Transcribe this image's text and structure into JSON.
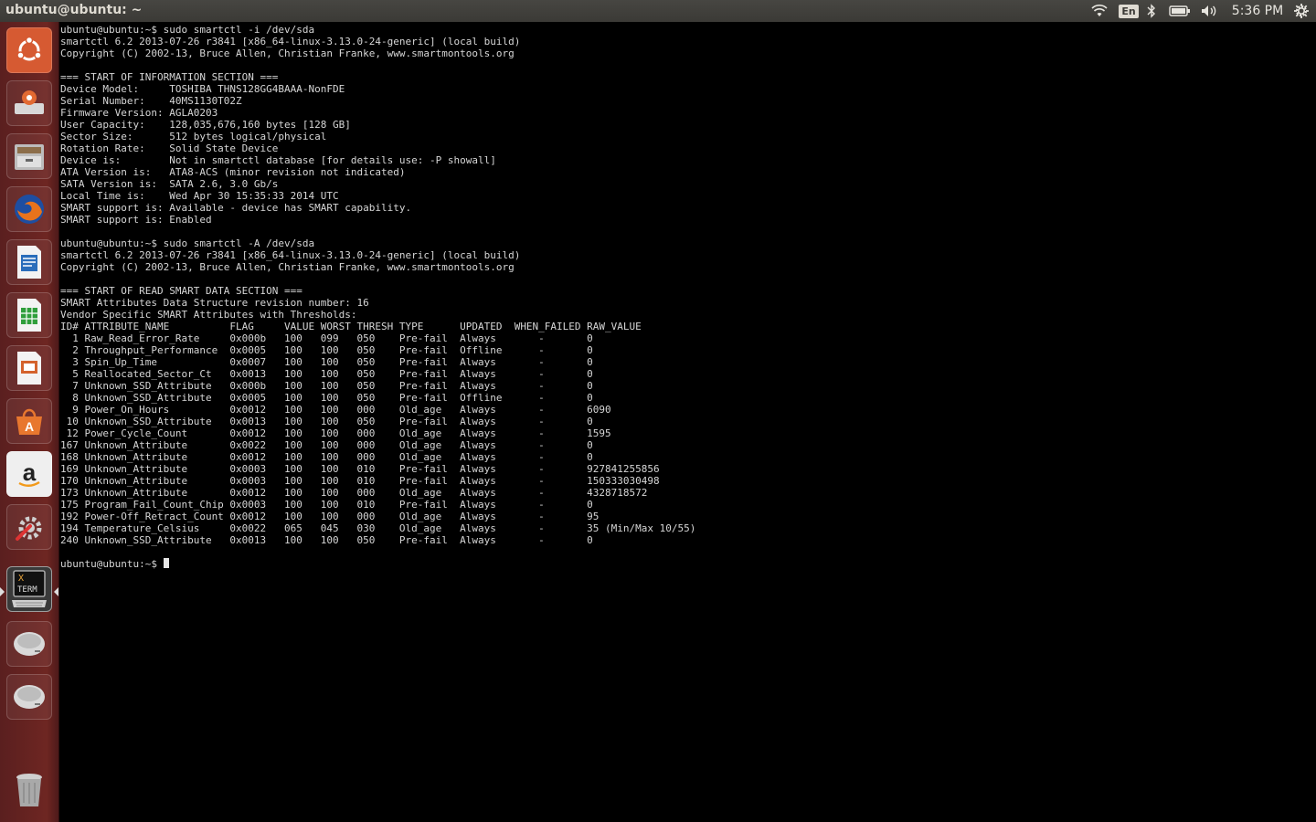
{
  "topbar": {
    "window_title": "ubuntu@ubuntu: ~",
    "language": "En",
    "clock": "5:36 PM",
    "icons": [
      "wifi-icon",
      "keyboard-language-icon",
      "bluetooth-icon",
      "battery-icon",
      "volume-icon",
      "session-gear-icon"
    ]
  },
  "launcher": {
    "items": [
      {
        "name": "ubuntu-dash-icon"
      },
      {
        "name": "system-installer-icon"
      },
      {
        "name": "files-icon"
      },
      {
        "name": "firefox-icon"
      },
      {
        "name": "libreoffice-writer-icon"
      },
      {
        "name": "libreoffice-calc-icon"
      },
      {
        "name": "libreoffice-impress-icon"
      },
      {
        "name": "software-center-icon"
      },
      {
        "name": "amazon-icon"
      },
      {
        "name": "system-settings-icon"
      },
      {
        "name": "xterm-icon",
        "label": "X TERM",
        "active": true
      },
      {
        "name": "drive-icon"
      },
      {
        "name": "drive-icon"
      },
      {
        "name": "trash-icon"
      }
    ]
  },
  "colors": {
    "launcher": "#6e2622",
    "topbar": "#3c3b37",
    "terminal_bg": "#000000",
    "terminal_fg": "#d6d6d6"
  },
  "terminal": {
    "lines": [
      "ubuntu@ubuntu:~$ sudo smartctl -i /dev/sda",
      "smartctl 6.2 2013-07-26 r3841 [x86_64-linux-3.13.0-24-generic] (local build)",
      "Copyright (C) 2002-13, Bruce Allen, Christian Franke, www.smartmontools.org",
      "",
      "=== START OF INFORMATION SECTION ===",
      "Device Model:     TOSHIBA THNS128GG4BAAA-NonFDE",
      "Serial Number:    40MS1130T02Z",
      "Firmware Version: AGLA0203",
      "User Capacity:    128,035,676,160 bytes [128 GB]",
      "Sector Size:      512 bytes logical/physical",
      "Rotation Rate:    Solid State Device",
      "Device is:        Not in smartctl database [for details use: -P showall]",
      "ATA Version is:   ATA8-ACS (minor revision not indicated)",
      "SATA Version is:  SATA 2.6, 3.0 Gb/s",
      "Local Time is:    Wed Apr 30 15:35:33 2014 UTC",
      "SMART support is: Available - device has SMART capability.",
      "SMART support is: Enabled",
      "",
      "ubuntu@ubuntu:~$ sudo smartctl -A /dev/sda",
      "smartctl 6.2 2013-07-26 r3841 [x86_64-linux-3.13.0-24-generic] (local build)",
      "Copyright (C) 2002-13, Bruce Allen, Christian Franke, www.smartmontools.org",
      "",
      "=== START OF READ SMART DATA SECTION ===",
      "SMART Attributes Data Structure revision number: 16",
      "Vendor Specific SMART Attributes with Thresholds:",
      "ID# ATTRIBUTE_NAME          FLAG     VALUE WORST THRESH TYPE      UPDATED  WHEN_FAILED RAW_VALUE",
      "  1 Raw_Read_Error_Rate     0x000b   100   099   050    Pre-fail  Always       -       0",
      "  2 Throughput_Performance  0x0005   100   100   050    Pre-fail  Offline      -       0",
      "  3 Spin_Up_Time            0x0007   100   100   050    Pre-fail  Always       -       0",
      "  5 Reallocated_Sector_Ct   0x0013   100   100   050    Pre-fail  Always       -       0",
      "  7 Unknown_SSD_Attribute   0x000b   100   100   050    Pre-fail  Always       -       0",
      "  8 Unknown_SSD_Attribute   0x0005   100   100   050    Pre-fail  Offline      -       0",
      "  9 Power_On_Hours          0x0012   100   100   000    Old_age   Always       -       6090",
      " 10 Unknown_SSD_Attribute   0x0013   100   100   050    Pre-fail  Always       -       0",
      " 12 Power_Cycle_Count       0x0012   100   100   000    Old_age   Always       -       1595",
      "167 Unknown_Attribute       0x0022   100   100   000    Old_age   Always       -       0",
      "168 Unknown_Attribute       0x0012   100   100   000    Old_age   Always       -       0",
      "169 Unknown_Attribute       0x0003   100   100   010    Pre-fail  Always       -       927841255856",
      "170 Unknown_Attribute       0x0003   100   100   010    Pre-fail  Always       -       150333030498",
      "173 Unknown_Attribute       0x0012   100   100   000    Old_age   Always       -       4328718572",
      "175 Program_Fail_Count_Chip 0x0003   100   100   010    Pre-fail  Always       -       0",
      "192 Power-Off_Retract_Count 0x0012   100   100   000    Old_age   Always       -       95",
      "194 Temperature_Celsius     0x0022   065   045   030    Old_age   Always       -       35 (Min/Max 10/55)",
      "240 Unknown_SSD_Attribute   0x0013   100   100   050    Pre-fail  Always       -       0",
      ""
    ],
    "prompt": "ubuntu@ubuntu:~$ "
  }
}
